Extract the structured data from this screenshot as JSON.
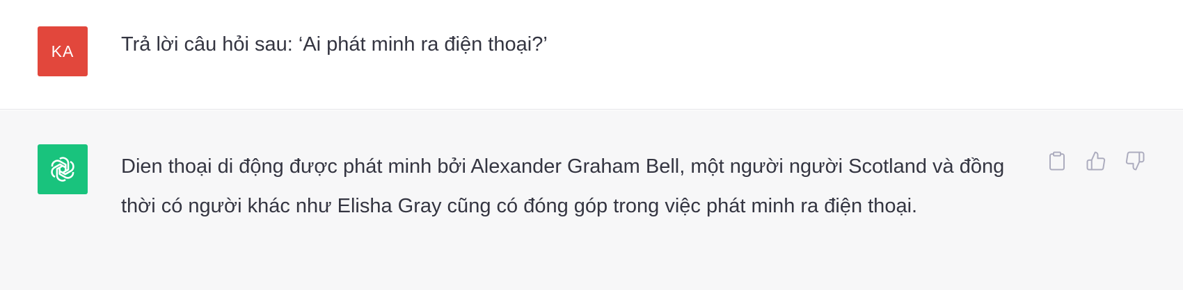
{
  "conversation": {
    "user_message": {
      "avatar_initials": "KA",
      "avatar_color": "#e2473c",
      "text": "Trả lời câu hỏi sau: ‘Ai phát minh ra điện thoại?’"
    },
    "assistant_message": {
      "avatar_icon": "openai-logo-icon",
      "avatar_color": "#19c37d",
      "text": "Dien thoại di động được phát minh bởi Alexander Graham Bell, một người người Scotland và đồng thời có người khác như Elisha Gray cũng có đóng góp trong việc phát minh ra điện thoại.",
      "actions": [
        {
          "name": "copy",
          "icon": "clipboard-icon"
        },
        {
          "name": "thumbs-up",
          "icon": "thumbs-up-icon"
        },
        {
          "name": "thumbs-down",
          "icon": "thumbs-down-icon"
        }
      ]
    }
  },
  "colors": {
    "text": "#343541",
    "assistant_bg": "#f7f7f8",
    "icon_gray": "#acacbe"
  }
}
